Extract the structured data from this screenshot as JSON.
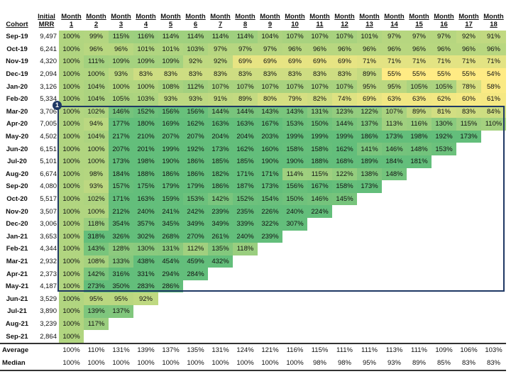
{
  "chart_data": {
    "type": "heatmap",
    "headers": {
      "cohort": "Cohort",
      "mrr_line1": "Initial",
      "mrr_line2": "MRR",
      "month_word": "Month",
      "months": [
        "1",
        "2",
        "3",
        "4",
        "5",
        "6",
        "7",
        "8",
        "9",
        "10",
        "11",
        "12",
        "13",
        "14",
        "15",
        "16",
        "17",
        "18"
      ]
    },
    "rows": [
      {
        "cohort": "Sep-19",
        "mrr": "9,497",
        "values": [
          100,
          99,
          115,
          116,
          114,
          114,
          114,
          114,
          104,
          107,
          107,
          107,
          101,
          97,
          97,
          97,
          92,
          91
        ]
      },
      {
        "cohort": "Oct-19",
        "mrr": "6,241",
        "values": [
          100,
          96,
          96,
          101,
          101,
          103,
          97,
          97,
          97,
          96,
          96,
          96,
          96,
          96,
          96,
          96,
          96,
          96
        ]
      },
      {
        "cohort": "Nov-19",
        "mrr": "4,320",
        "values": [
          100,
          111,
          109,
          109,
          109,
          92,
          92,
          69,
          69,
          69,
          69,
          69,
          71,
          71,
          71,
          71,
          71,
          71
        ]
      },
      {
        "cohort": "Dec-19",
        "mrr": "2,094",
        "values": [
          100,
          100,
          93,
          83,
          83,
          83,
          83,
          83,
          83,
          83,
          83,
          83,
          89,
          55,
          55,
          55,
          55,
          54
        ]
      },
      {
        "cohort": "Jan-20",
        "mrr": "3,126",
        "values": [
          100,
          104,
          100,
          100,
          108,
          112,
          107,
          107,
          107,
          107,
          107,
          107,
          95,
          95,
          105,
          105,
          78,
          58
        ]
      },
      {
        "cohort": "Feb-20",
        "mrr": "5,334",
        "values": [
          100,
          104,
          105,
          103,
          93,
          93,
          91,
          89,
          80,
          79,
          82,
          74,
          69,
          63,
          63,
          62,
          60,
          61
        ]
      },
      {
        "cohort": "Mar-20",
        "mrr": "3,706",
        "values": [
          100,
          102,
          146,
          152,
          156,
          156,
          144,
          144,
          143,
          143,
          131,
          123,
          122,
          107,
          89,
          81,
          83,
          84
        ]
      },
      {
        "cohort": "Apr-20",
        "mrr": "7,005",
        "values": [
          100,
          94,
          177,
          180,
          169,
          162,
          163,
          163,
          167,
          153,
          150,
          144,
          137,
          113,
          116,
          130,
          115,
          110
        ]
      },
      {
        "cohort": "May-20",
        "mrr": "4,502",
        "values": [
          100,
          104,
          217,
          210,
          207,
          207,
          204,
          204,
          203,
          199,
          199,
          199,
          186,
          173,
          198,
          192,
          173
        ]
      },
      {
        "cohort": "Jun-20",
        "mrr": "6,151",
        "values": [
          100,
          100,
          207,
          201,
          199,
          192,
          173,
          162,
          160,
          158,
          158,
          162,
          141,
          146,
          148,
          153
        ]
      },
      {
        "cohort": "Jul-20",
        "mrr": "5,101",
        "values": [
          100,
          100,
          173,
          198,
          190,
          186,
          185,
          185,
          190,
          190,
          188,
          168,
          189,
          184,
          181
        ]
      },
      {
        "cohort": "Aug-20",
        "mrr": "6,674",
        "values": [
          100,
          98,
          184,
          188,
          186,
          186,
          182,
          171,
          171,
          114,
          115,
          122,
          138,
          148
        ]
      },
      {
        "cohort": "Sep-20",
        "mrr": "4,080",
        "values": [
          100,
          93,
          157,
          175,
          179,
          179,
          186,
          187,
          173,
          156,
          167,
          158,
          173
        ]
      },
      {
        "cohort": "Oct-20",
        "mrr": "5,517",
        "values": [
          100,
          102,
          171,
          163,
          159,
          153,
          142,
          152,
          154,
          150,
          146,
          145
        ]
      },
      {
        "cohort": "Nov-20",
        "mrr": "3,507",
        "values": [
          100,
          100,
          212,
          240,
          241,
          242,
          239,
          235,
          226,
          240,
          224
        ]
      },
      {
        "cohort": "Dec-20",
        "mrr": "3,006",
        "values": [
          100,
          118,
          354,
          357,
          345,
          349,
          349,
          339,
          322,
          307
        ]
      },
      {
        "cohort": "Jan-21",
        "mrr": "3,653",
        "values": [
          100,
          318,
          326,
          302,
          268,
          270,
          261,
          240,
          239
        ]
      },
      {
        "cohort": "Feb-21",
        "mrr": "4,344",
        "values": [
          100,
          143,
          128,
          130,
          131,
          112,
          135,
          118
        ]
      },
      {
        "cohort": "Mar-21",
        "mrr": "2,932",
        "values": [
          100,
          108,
          133,
          438,
          454,
          459,
          432
        ]
      },
      {
        "cohort": "Apr-21",
        "mrr": "2,373",
        "values": [
          100,
          142,
          316,
          331,
          294,
          284
        ]
      },
      {
        "cohort": "May-21",
        "mrr": "4,187",
        "values": [
          100,
          273,
          350,
          283,
          286
        ]
      },
      {
        "cohort": "Jun-21",
        "mrr": "3,529",
        "values": [
          100,
          95,
          95,
          92
        ]
      },
      {
        "cohort": "Jul-21",
        "mrr": "3,890",
        "values": [
          100,
          139,
          137
        ]
      },
      {
        "cohort": "Aug-21",
        "mrr": "3,239",
        "values": [
          100,
          117
        ]
      },
      {
        "cohort": "Sep-21",
        "mrr": "2,864",
        "values": [
          100
        ]
      }
    ],
    "summary": [
      {
        "label": "Average",
        "values": [
          100,
          110,
          131,
          139,
          137,
          135,
          131,
          124,
          121,
          116,
          115,
          111,
          111,
          113,
          111,
          109,
          106,
          103
        ]
      },
      {
        "label": "Median",
        "values": [
          100,
          100,
          100,
          100,
          100,
          100,
          100,
          100,
          100,
          100,
          98,
          98,
          95,
          93,
          89,
          85,
          83,
          83
        ]
      }
    ],
    "unit": "%",
    "color_scale": {
      "low": "#ffeb84",
      "mid": "#b1d580",
      "high": "#63be7b"
    },
    "highlight": {
      "label": "1",
      "from_cohort": "Mar-20",
      "to_cohort": "May-21",
      "color": "#1f3864"
    }
  }
}
